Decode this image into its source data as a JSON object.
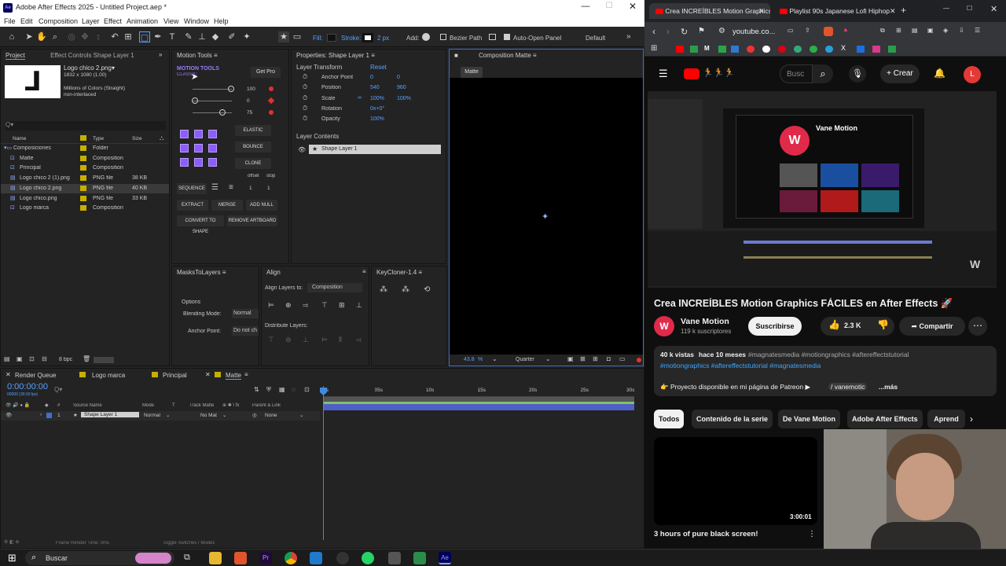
{
  "ae": {
    "window_title": "Adobe After Effects 2025 - Untitled Project.aep *",
    "menu": [
      "File",
      "Edit",
      "Composition",
      "Layer",
      "Effect",
      "Animation",
      "View",
      "Window",
      "Help"
    ],
    "toolbar": {
      "fill": "Fill:",
      "stroke": "Stroke:",
      "stroke_px": "2 px",
      "add": "Add:",
      "bezier": "Bezier Path",
      "auto_open": "Auto-Open Panel",
      "workspace": "Default"
    },
    "project": {
      "tab": "Project",
      "effect_controls_tab": "Effect Controls Shape Layer 1",
      "preview_name": "Logo chico 2.png▾",
      "preview_size": "1832 x 1080 (1.00)",
      "preview_colors": "Millions of Colors (Straight)",
      "preview_interlace": "non-interlaced",
      "search_placeholder": "Q▾",
      "cols": {
        "name": "Name",
        "type": "Type",
        "size": "Size"
      },
      "items": [
        {
          "name": "Composiciones",
          "type": "Folder",
          "size": "",
          "color": "#c6b000"
        },
        {
          "name": "Matte",
          "type": "Composition",
          "size": "",
          "color": "#c6b000"
        },
        {
          "name": "Principal",
          "type": "Composition",
          "size": "",
          "color": "#c6b000"
        },
        {
          "name": "Logo chico 2 (1).png",
          "type": "PNG file",
          "size": "38 KB",
          "color": "#c6b000"
        },
        {
          "name": "Logo chico 2.png",
          "type": "PNG file",
          "size": "40 KB",
          "color": "#c6b000"
        },
        {
          "name": "Logo chico.png",
          "type": "PNG file",
          "size": "33 KB",
          "color": "#c6b000"
        },
        {
          "name": "Logo marca",
          "type": "Composition",
          "size": "",
          "color": "#c6b000"
        }
      ],
      "bpc": "8 bpc"
    },
    "motion_tools": {
      "tab": "Motion Tools",
      "logo": "MOTION TOOLS",
      "logo_sub": "CLASSIC",
      "get_pro": "Get Pro",
      "v1": "100",
      "v2": "0",
      "v3": "75",
      "elastic": "ELASTIC",
      "bounce": "BOUNCE",
      "clone": "CLONE",
      "offset": "offset",
      "stop": "stop",
      "sequence": "SEQUENCE",
      "n1": "1",
      "n2": "1",
      "extract": "EXTRACT",
      "merge": "MERGE",
      "add_null": "ADD NULL",
      "convert": "CONVERT TO SHAPE",
      "remove": "REMOVE ARTBOARD"
    },
    "properties": {
      "tab": "Properties: Shape Layer 1",
      "section": "Layer Transform",
      "reset": "Reset",
      "rows": [
        {
          "label": "Anchor Point",
          "v1": "0",
          "v2": "0"
        },
        {
          "label": "Position",
          "v1": "540",
          "v2": "960"
        },
        {
          "label": "Scale",
          "v1": "100%",
          "v2": "100%"
        },
        {
          "label": "Rotation",
          "v1": "0x+0°",
          "v2": ""
        },
        {
          "label": "Opacity",
          "v1": "100%",
          "v2": ""
        }
      ],
      "contents": "Layer Contents",
      "layer": "Shape Layer 1"
    },
    "composition": {
      "tab": "Composition Matte",
      "chip": "Matte",
      "zoom": "43.8",
      "zoom_unit": "%",
      "quality": "Quarter"
    },
    "masks": {
      "tab": "MasksToLayers",
      "options": "Options",
      "blending_label": "Blending Mode:",
      "blending_value": "Normal",
      "anchor_label": "Anchor Point:",
      "anchor_value": "Do not ch"
    },
    "align": {
      "tab": "Align",
      "align_to_label": "Align Layers to:",
      "align_to_value": "Composition",
      "distribute": "Distribute Layers:"
    },
    "keycloner": {
      "tab": "KeyCloner-1.4"
    },
    "timeline": {
      "tabs": [
        "Render Queue",
        "Logo marca",
        "Principal",
        "Matte"
      ],
      "timecode": "0:00:00:00",
      "fps": "00000 (30.00 fps)",
      "cols": {
        "source": "Source Name",
        "mode": "Mode",
        "track": "Track Matte",
        "parent": "Parent & Link"
      },
      "layer": {
        "num": "1",
        "name": "Shape Layer 1",
        "mode": "Normal",
        "matte": "No Mat",
        "parent": "None"
      },
      "ruler": [
        "0s",
        "05s",
        "10s",
        "15s",
        "20s",
        "25s",
        "30s"
      ],
      "footer_left": "Frame Render Time: 0ms",
      "footer_right": "Toggle Switches / Modes"
    }
  },
  "chrome": {
    "tabs": [
      {
        "title": "Crea INCREÍBLES Motion Graphics"
      },
      {
        "title": "Playlist 90s Japanese Lofi Hiphop"
      }
    ],
    "url": "youtube.co...",
    "yt_search_placeholder": "Busc",
    "create": "Crear",
    "avatar_letter": "L",
    "video_thumb_channel": "Vane Motion",
    "video_title": "Crea INCREÍBLES Motion Graphics FÁCILES en After Effects 🚀",
    "channel": "Vane Motion",
    "subs": "119 k suscriptores",
    "subscribe": "Suscribirse",
    "likes": "2.3 K",
    "share": "Compartir",
    "views": "40 k vistas",
    "date": "hace 10 meses",
    "tags1": "#magnatesmedia #motiongraphics #aftereffectstutorial",
    "tags2": "#motiongraphics #aftereffectstutorial #magnatesmedia",
    "desc": "👉 Proyecto disponible en mi página de Patreon ▶",
    "desc_link": "/ vanemotic",
    "more": "...más",
    "chips": [
      "Todos",
      "Contenido de la serie",
      "De Vane Motion",
      "Adobe After Effects",
      "Aprend"
    ],
    "next_video_duration": "3:00:01",
    "next_video_title": "3 hours of pure black screen!"
  },
  "taskbar": {
    "search": "Buscar"
  }
}
